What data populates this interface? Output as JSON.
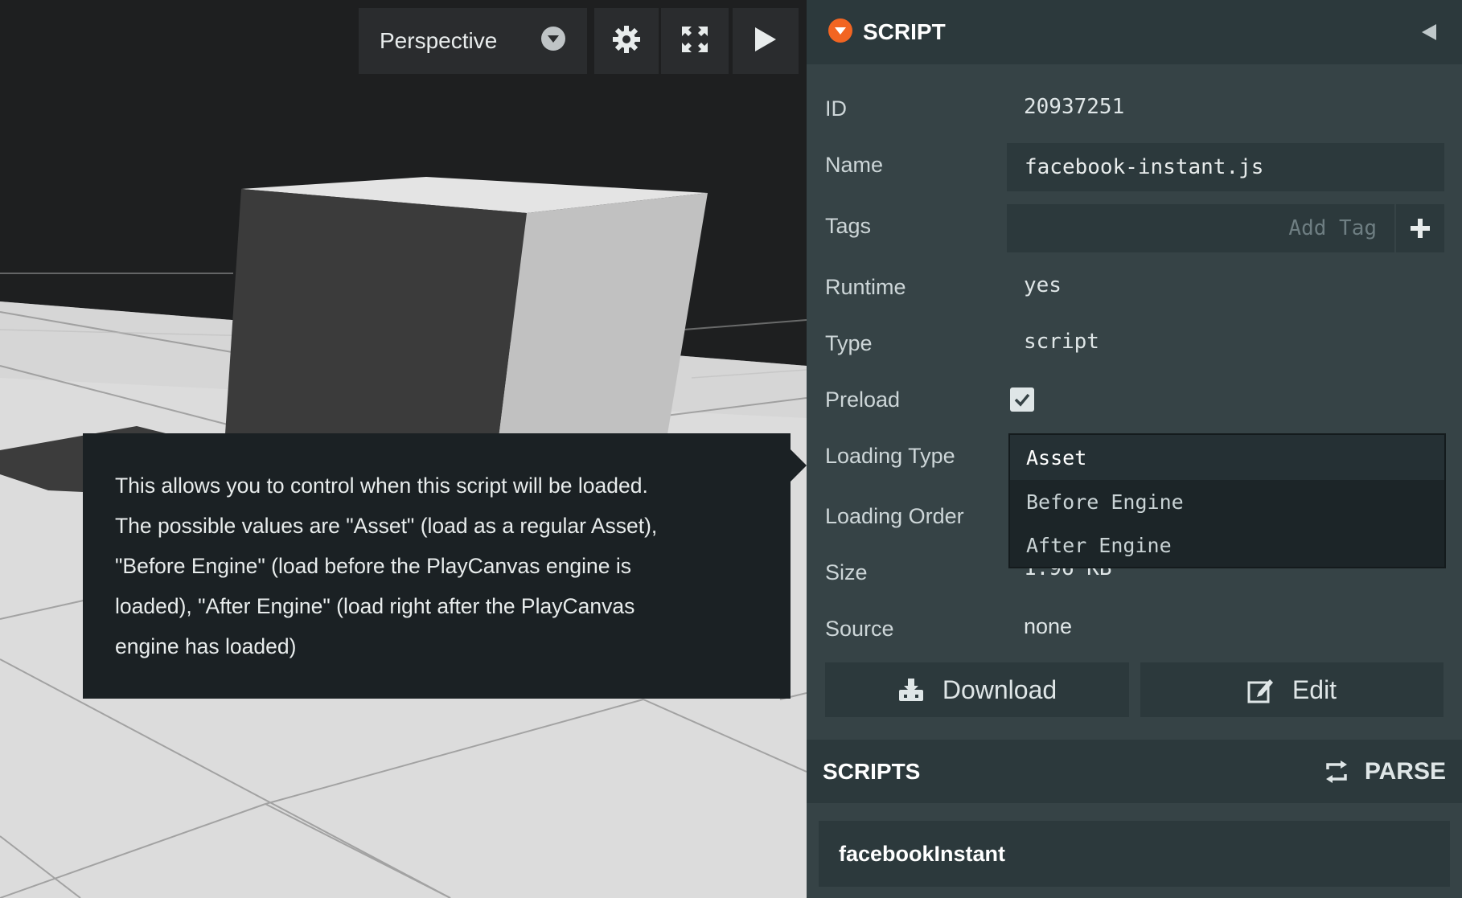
{
  "viewport": {
    "camera_label": "Perspective",
    "icons": [
      "chevron-down-icon",
      "gear-icon",
      "fullscreen-icon",
      "play-icon"
    ]
  },
  "tooltip": {
    "lines": [
      "This allows you to control when this script will be loaded.",
      "The possible values are \"Asset\" (load as a regular Asset),",
      "\"Before Engine\" (load before the PlayCanvas engine is",
      "loaded), \"After Engine\" (load right after the PlayCanvas",
      "engine has loaded)"
    ]
  },
  "panel": {
    "title": "SCRIPT",
    "fields": {
      "id_label": "ID",
      "id_value": "20937251",
      "name_label": "Name",
      "name_value": "facebook-instant.js",
      "tags_label": "Tags",
      "tags_placeholder": "Add Tag",
      "runtime_label": "Runtime",
      "runtime_value": "yes",
      "type_label": "Type",
      "type_value": "script",
      "preload_label": "Preload",
      "preload_checked": true,
      "loading_type_label": "Loading Type",
      "loading_order_label": "Loading Order",
      "size_label": "Size",
      "size_value": "1.96 KB",
      "source_label": "Source",
      "source_value": "none"
    },
    "loading_type_options": [
      "Asset",
      "Before Engine",
      "After Engine"
    ],
    "loading_type_selected": "Asset",
    "buttons": {
      "download": "Download",
      "edit": "Edit"
    },
    "scripts": {
      "title": "SCRIPTS",
      "parse_label": "PARSE",
      "items": [
        "facebookInstant"
      ]
    }
  },
  "colors": {
    "accent": "#f26522",
    "panel_bg": "#364346",
    "panel_dark": "#2c393c",
    "tooltip_bg": "#1b2124"
  }
}
